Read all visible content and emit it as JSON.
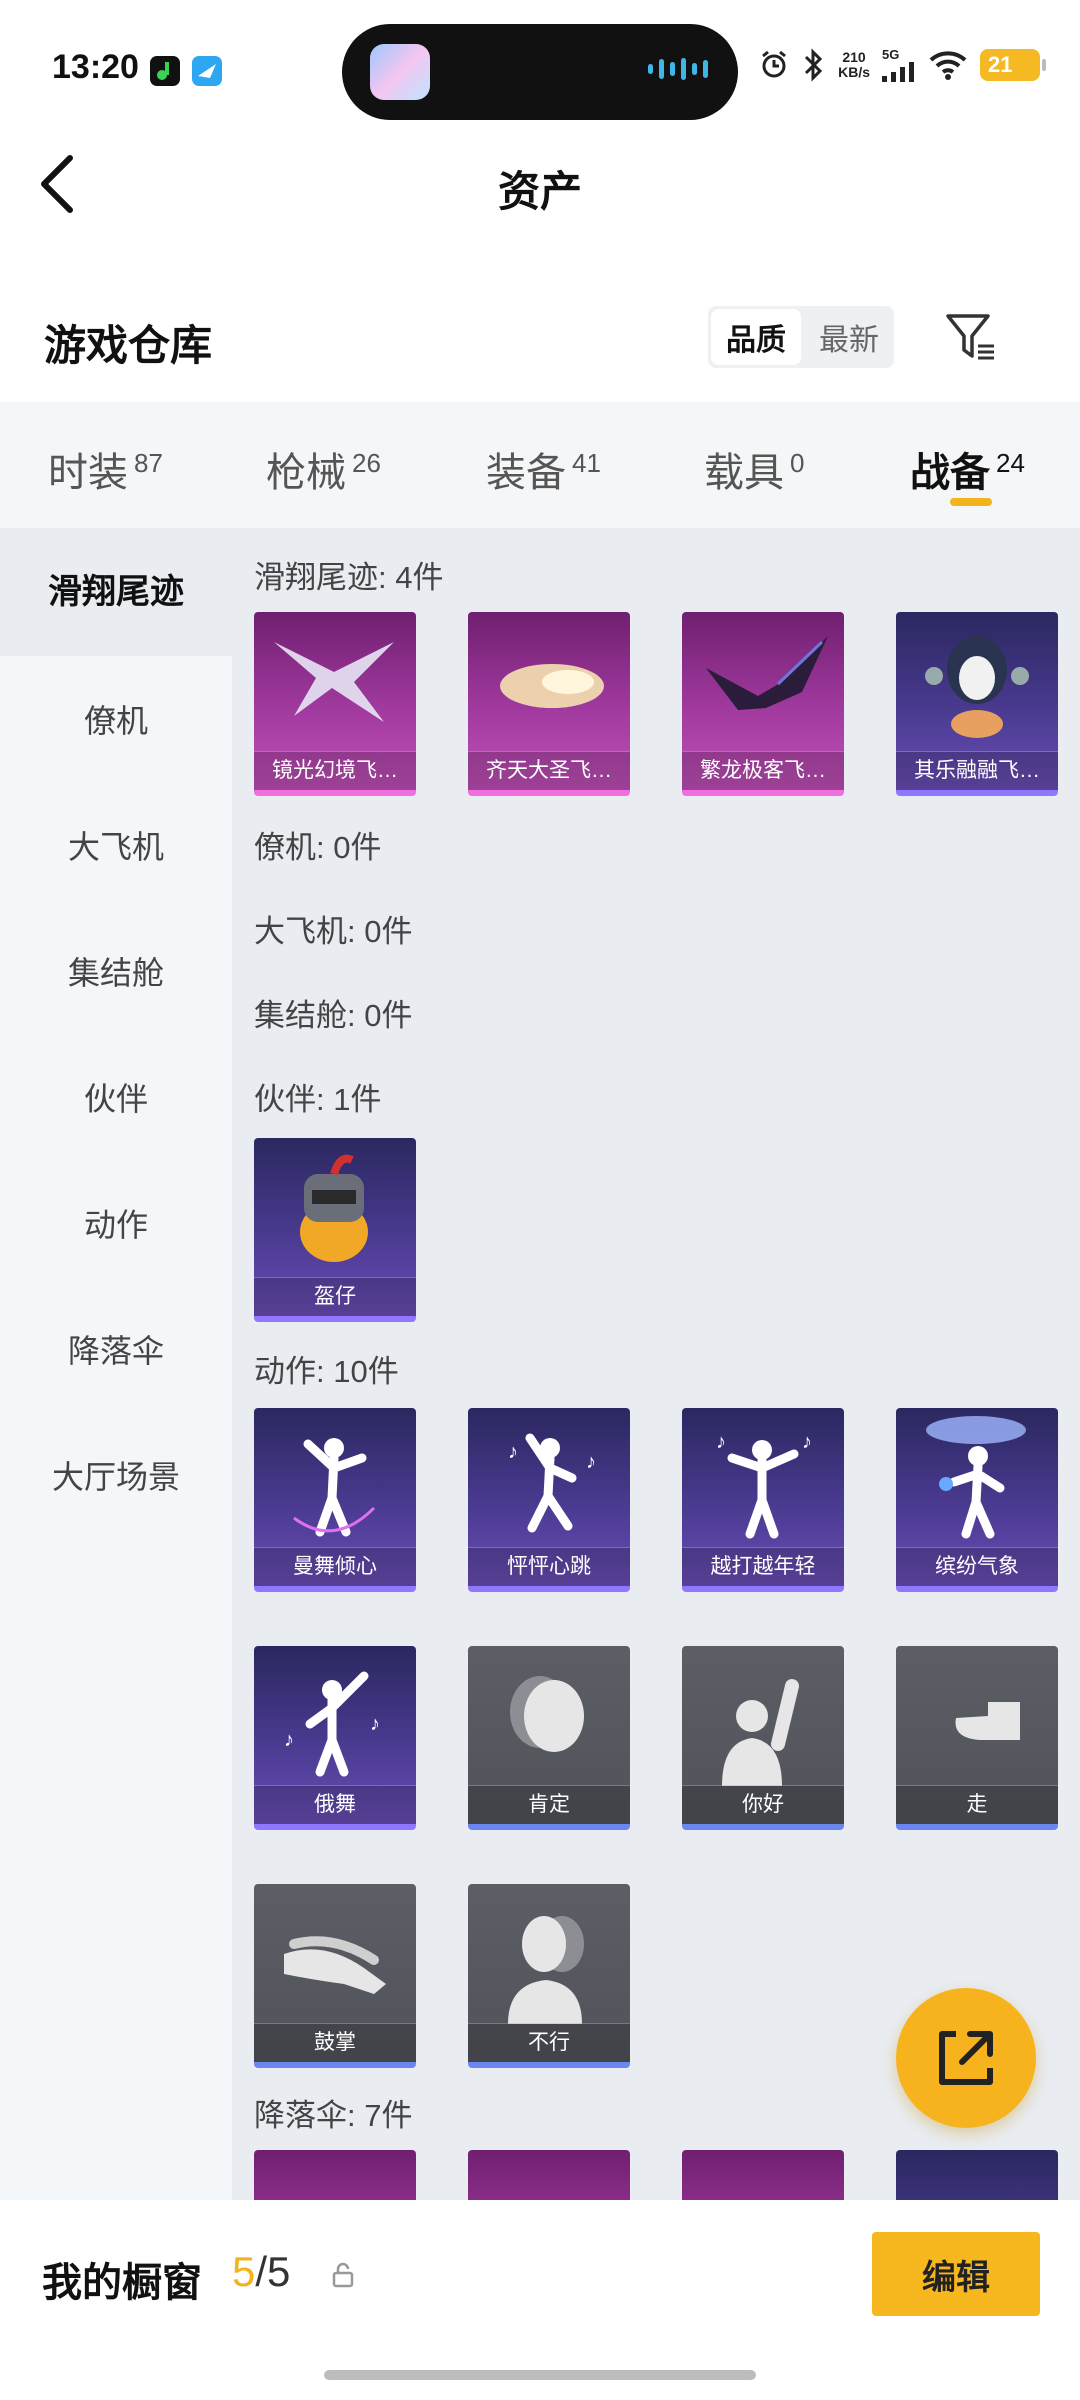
{
  "status": {
    "time": "13:20",
    "speed_value": "210",
    "speed_unit": "KB/s",
    "network": "5G",
    "battery": "21"
  },
  "nav": {
    "title": "资产"
  },
  "warehouse": {
    "title": "游戏仓库",
    "sort_options": [
      "品质",
      "最新"
    ],
    "selected_sort": "品质"
  },
  "tabs": [
    {
      "label": "时装",
      "count": "87"
    },
    {
      "label": "枪械",
      "count": "26"
    },
    {
      "label": "装备",
      "count": "41"
    },
    {
      "label": "载具",
      "count": "0"
    },
    {
      "label": "战备",
      "count": "24",
      "active": true
    }
  ],
  "side_menu": [
    "滑翔尾迹",
    "僚机",
    "大飞机",
    "集结舱",
    "伙伴",
    "动作",
    "降落伞",
    "大厅场景"
  ],
  "sections": [
    {
      "title": "滑翔尾迹: 4件",
      "items": [
        {
          "name": "镜光幻境飞…",
          "rarity": "pink",
          "icon": "wing-trail-icon"
        },
        {
          "name": "齐天大圣飞…",
          "rarity": "pink",
          "icon": "cloud-trail-icon"
        },
        {
          "name": "繁龙极客飞…",
          "rarity": "pink",
          "icon": "dragon-wing-icon"
        },
        {
          "name": "其乐融融飞…",
          "rarity": "purple",
          "icon": "penguin-icon"
        }
      ]
    },
    {
      "title": "僚机: 0件",
      "items": []
    },
    {
      "title": "大飞机: 0件",
      "items": []
    },
    {
      "title": "集结舱: 0件",
      "items": []
    },
    {
      "title": "伙伴: 1件",
      "items": [
        {
          "name": "盔仔",
          "rarity": "purple",
          "icon": "helmet-chick-icon"
        }
      ]
    },
    {
      "title": "动作: 10件",
      "items": [
        {
          "name": "曼舞倾心",
          "rarity": "purple",
          "icon": "dance-icon"
        },
        {
          "name": "怦怦心跳",
          "rarity": "purple",
          "icon": "dance-icon"
        },
        {
          "name": "越打越年轻",
          "rarity": "purple",
          "icon": "dance-icon"
        },
        {
          "name": "缤纷气象",
          "rarity": "purple",
          "icon": "dance-icon"
        },
        {
          "name": "俄舞",
          "rarity": "purple",
          "icon": "dance-icon"
        },
        {
          "name": "肯定",
          "rarity": "gray",
          "icon": "nod-icon"
        },
        {
          "name": "你好",
          "rarity": "gray",
          "icon": "wave-hand-icon"
        },
        {
          "name": "走",
          "rarity": "gray",
          "icon": "point-hand-icon"
        },
        {
          "name": "鼓掌",
          "rarity": "gray",
          "icon": "clap-icon"
        },
        {
          "name": "不行",
          "rarity": "gray",
          "icon": "shake-head-icon"
        }
      ]
    },
    {
      "title": "降落伞: 7件",
      "items": []
    }
  ],
  "showcase": {
    "title": "我的橱窗",
    "count_current": "5",
    "count_sep_total": "/5",
    "edit_label": "编辑"
  },
  "colors": {
    "accent": "#f2b31b",
    "rarity_pink": "#f06ee0",
    "rarity_purple": "#8f78ff",
    "rarity_gray": "#6b86f0"
  }
}
